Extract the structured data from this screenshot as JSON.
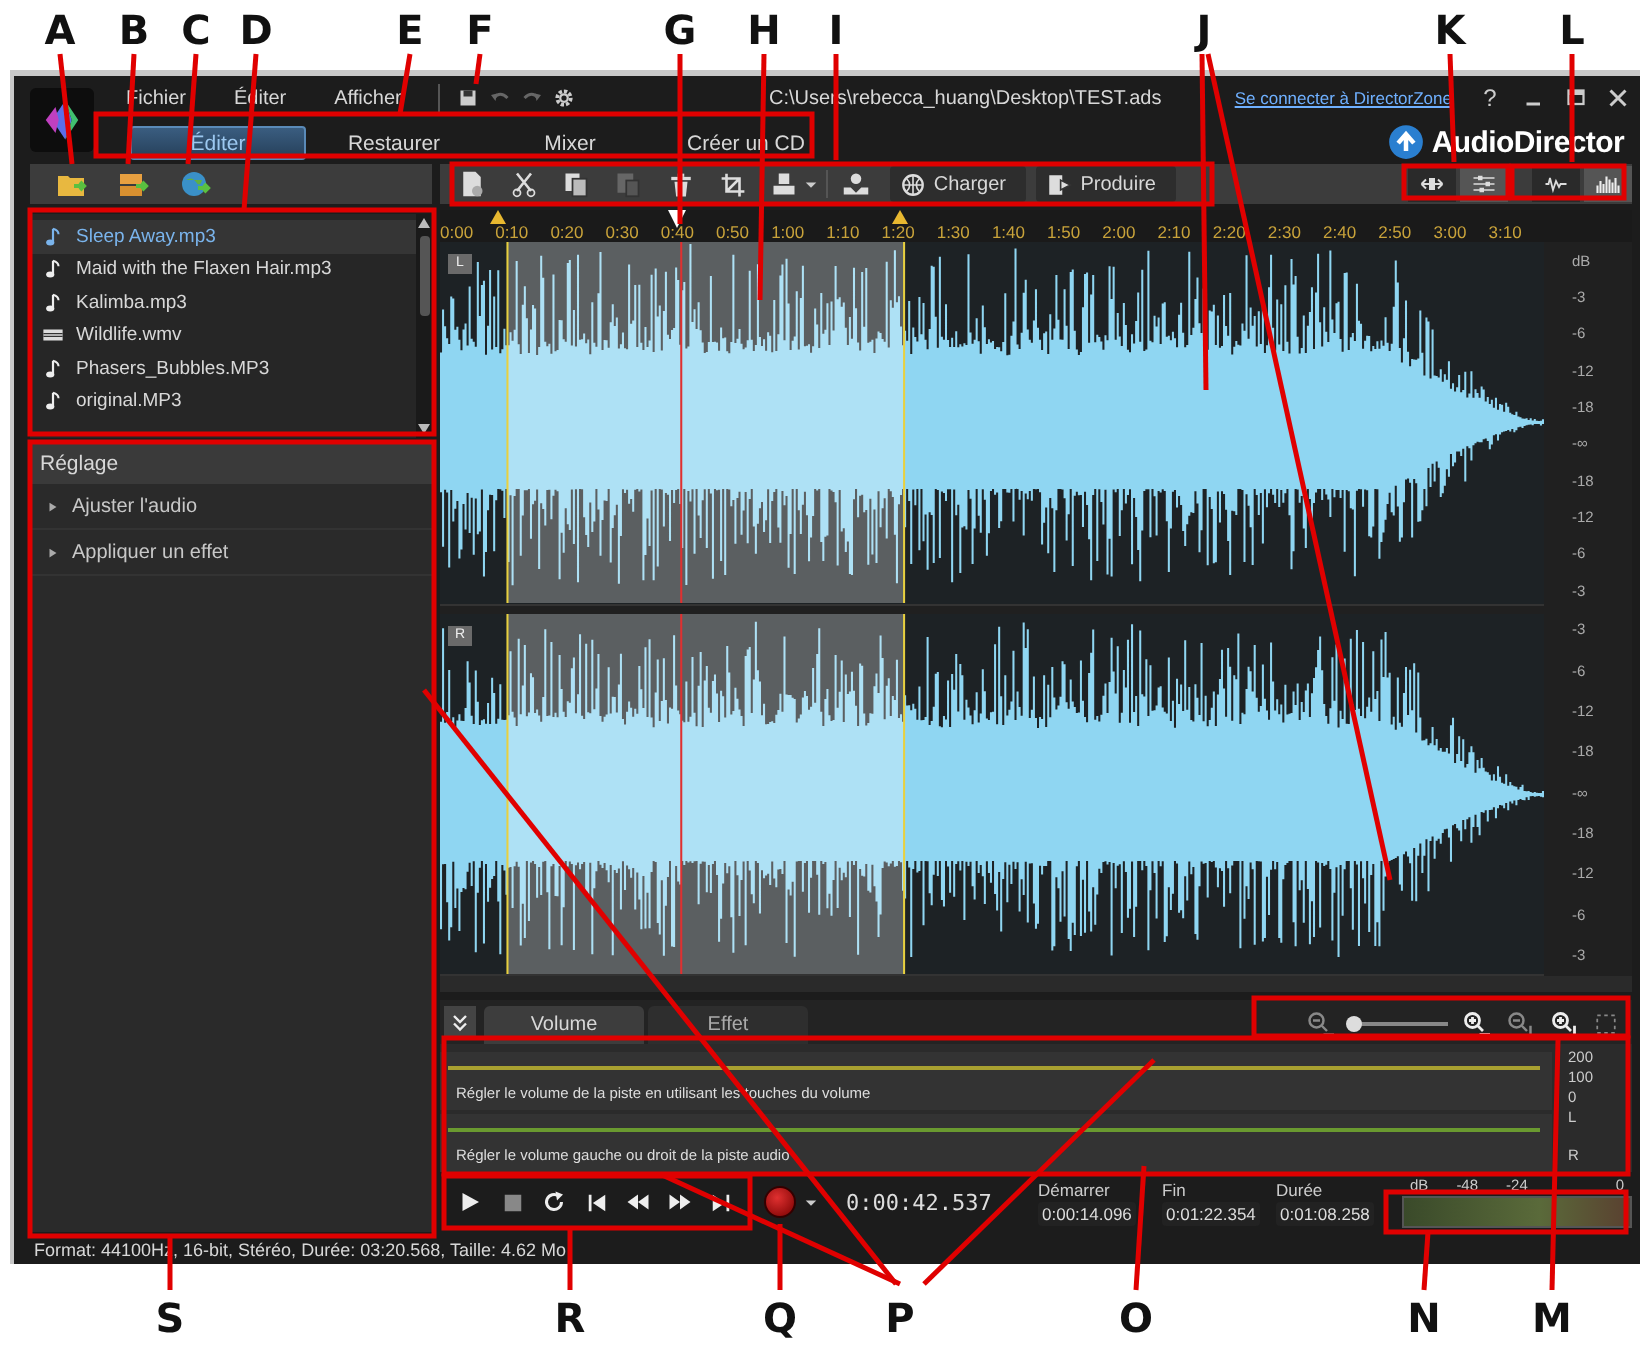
{
  "callouts": {
    "top": [
      "A",
      "B",
      "C",
      "D",
      "E",
      "F",
      "G",
      "H",
      "I",
      "J",
      "K",
      "L"
    ],
    "bottom": [
      "S",
      "R",
      "Q",
      "P",
      "O",
      "N",
      "M"
    ]
  },
  "window": {
    "menu": [
      "Fichier",
      "Éditer",
      "Afficher"
    ],
    "title": "C:\\Users\\rebecca_huang\\Desktop\\TEST.ads",
    "signin_link": "Se connecter à DirectorZone",
    "help": "?",
    "brand": "AudioDirector"
  },
  "mode_tabs": [
    {
      "label": "Éditer",
      "selected": true
    },
    {
      "label": "Restaurer",
      "selected": false
    },
    {
      "label": "Mixer",
      "selected": false
    },
    {
      "label": "Créer un CD",
      "selected": false
    }
  ],
  "library": {
    "files": [
      {
        "name": "Sleep Away.mp3",
        "kind": "audio",
        "selected": true
      },
      {
        "name": "Maid with the Flaxen Hair.mp3",
        "kind": "audio",
        "selected": false
      },
      {
        "name": "Kalimba.mp3",
        "kind": "audio",
        "selected": false
      },
      {
        "name": "Wildlife.wmv",
        "kind": "video",
        "selected": false
      },
      {
        "name": "Phasers_Bubbles.MP3",
        "kind": "audio",
        "selected": false
      },
      {
        "name": "original.MP3",
        "kind": "audio",
        "selected": false
      }
    ]
  },
  "adjust_panel": {
    "title": "Réglage",
    "items": [
      "Ajuster l'audio",
      "Appliquer un effet"
    ]
  },
  "toolbar": {
    "buttons": [
      "Charger",
      "Produire"
    ]
  },
  "ruler": [
    "0:00",
    "0:10",
    "0:20",
    "0:30",
    "0:40",
    "0:50",
    "1:00",
    "1:10",
    "1:20",
    "1:30",
    "1:40",
    "1:50",
    "2:00",
    "2:10",
    "2:20",
    "2:30",
    "2:40",
    "2:50",
    "3:00",
    "3:10"
  ],
  "channels": [
    {
      "tag": "L",
      "scale": [
        "dB",
        "-3",
        "-6",
        "-12",
        "-18",
        "-∞",
        "-18",
        "-12",
        "-6",
        "-3"
      ]
    },
    {
      "tag": "R",
      "scale": [
        "-3",
        "-6",
        "-12",
        "-18",
        "-∞",
        "-18",
        "-12",
        "-6",
        "-3"
      ]
    }
  ],
  "bottom_panel": {
    "tabs": [
      {
        "label": "Volume",
        "selected": true
      },
      {
        "label": "Effet",
        "selected": false
      }
    ],
    "zoom": {
      "level": 0.05
    },
    "lanes": [
      {
        "hint": "Régler le volume de la piste en utilisant les touches du volume",
        "scale": [
          "200",
          "100",
          "0"
        ]
      },
      {
        "hint": "Régler le volume gauche ou droit de la piste audio",
        "scale": [
          "L",
          "R"
        ]
      }
    ]
  },
  "transport": {
    "time": "0:00:42.537",
    "fields": [
      {
        "label": "Démarrer",
        "value": "0:00:14.096"
      },
      {
        "label": "Fin",
        "value": "0:01:22.354"
      },
      {
        "label": "Durée",
        "value": "0:01:08.258"
      }
    ]
  },
  "meter": {
    "scale": [
      "dB",
      "-48",
      "-24",
      "0"
    ]
  },
  "status_bar": "Format: 44100Hz, 16-bit, Stéréo, Durée: 03:20.568, Taille: 4.62 Mo"
}
